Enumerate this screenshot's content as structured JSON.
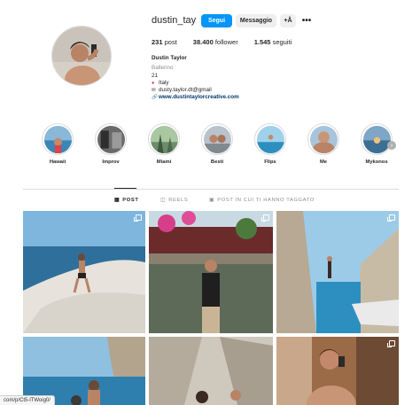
{
  "profile": {
    "username": "dustin_tay",
    "follow_label": "Segui",
    "message_label": "Messaggio",
    "suggest_icon": "add-person-icon",
    "suggest_glyph": "+Å",
    "more_glyph": "•••",
    "stats": {
      "posts_value": "231",
      "posts_label": "post",
      "followers_value": "38.400",
      "followers_label": "follower",
      "following_value": "1.545",
      "following_label": "seguiti"
    },
    "bio": {
      "full_name": "Dustin Taylor",
      "category": "Ballerino",
      "age": "21",
      "location": "Italy",
      "email": "dusty.taylor.dt@gmail",
      "link": "www.dustintaylorcreative.com"
    }
  },
  "highlights": [
    {
      "label": "Hawaii"
    },
    {
      "label": "Improv"
    },
    {
      "label": "Miami"
    },
    {
      "label": "Besti"
    },
    {
      "label": "Flips"
    },
    {
      "label": "Me"
    },
    {
      "label": "Mykonos"
    }
  ],
  "tabs": [
    {
      "label": "POST",
      "icon": "grid-icon",
      "active": true
    },
    {
      "label": "REELS",
      "icon": "reels-icon",
      "active": false
    },
    {
      "label": "POST IN CUI TI HANNO TAGGATO",
      "icon": "tagged-icon",
      "active": false
    }
  ],
  "status_bar": {
    "url": "com/p/Ct5-lTWoig0/"
  },
  "colors": {
    "primary_blue": "#0095f6",
    "secondary_button": "#efefef",
    "link": "#00376b",
    "muted": "#8e8e8e"
  }
}
